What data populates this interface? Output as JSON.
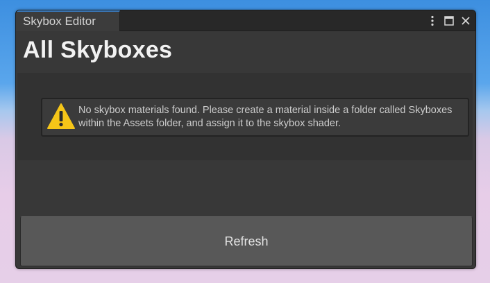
{
  "window": {
    "tab_title": "Skybox Editor",
    "controls": {
      "menu_icon": "kebab-menu-icon",
      "maximize_icon": "maximize-icon",
      "close_icon": "close-icon"
    }
  },
  "main": {
    "title": "All Skyboxes",
    "warning": {
      "icon": "warning-triangle-icon",
      "message": "No skybox materials found. Please create a material inside a folder called Skyboxes within the Assets folder, and assign it to the skybox shader."
    },
    "refresh_label": "Refresh"
  },
  "colors": {
    "window_bg": "#383838",
    "tab_accent": "#3a79bb",
    "warning_yellow": "#f5c518",
    "button_bg": "#585858"
  }
}
